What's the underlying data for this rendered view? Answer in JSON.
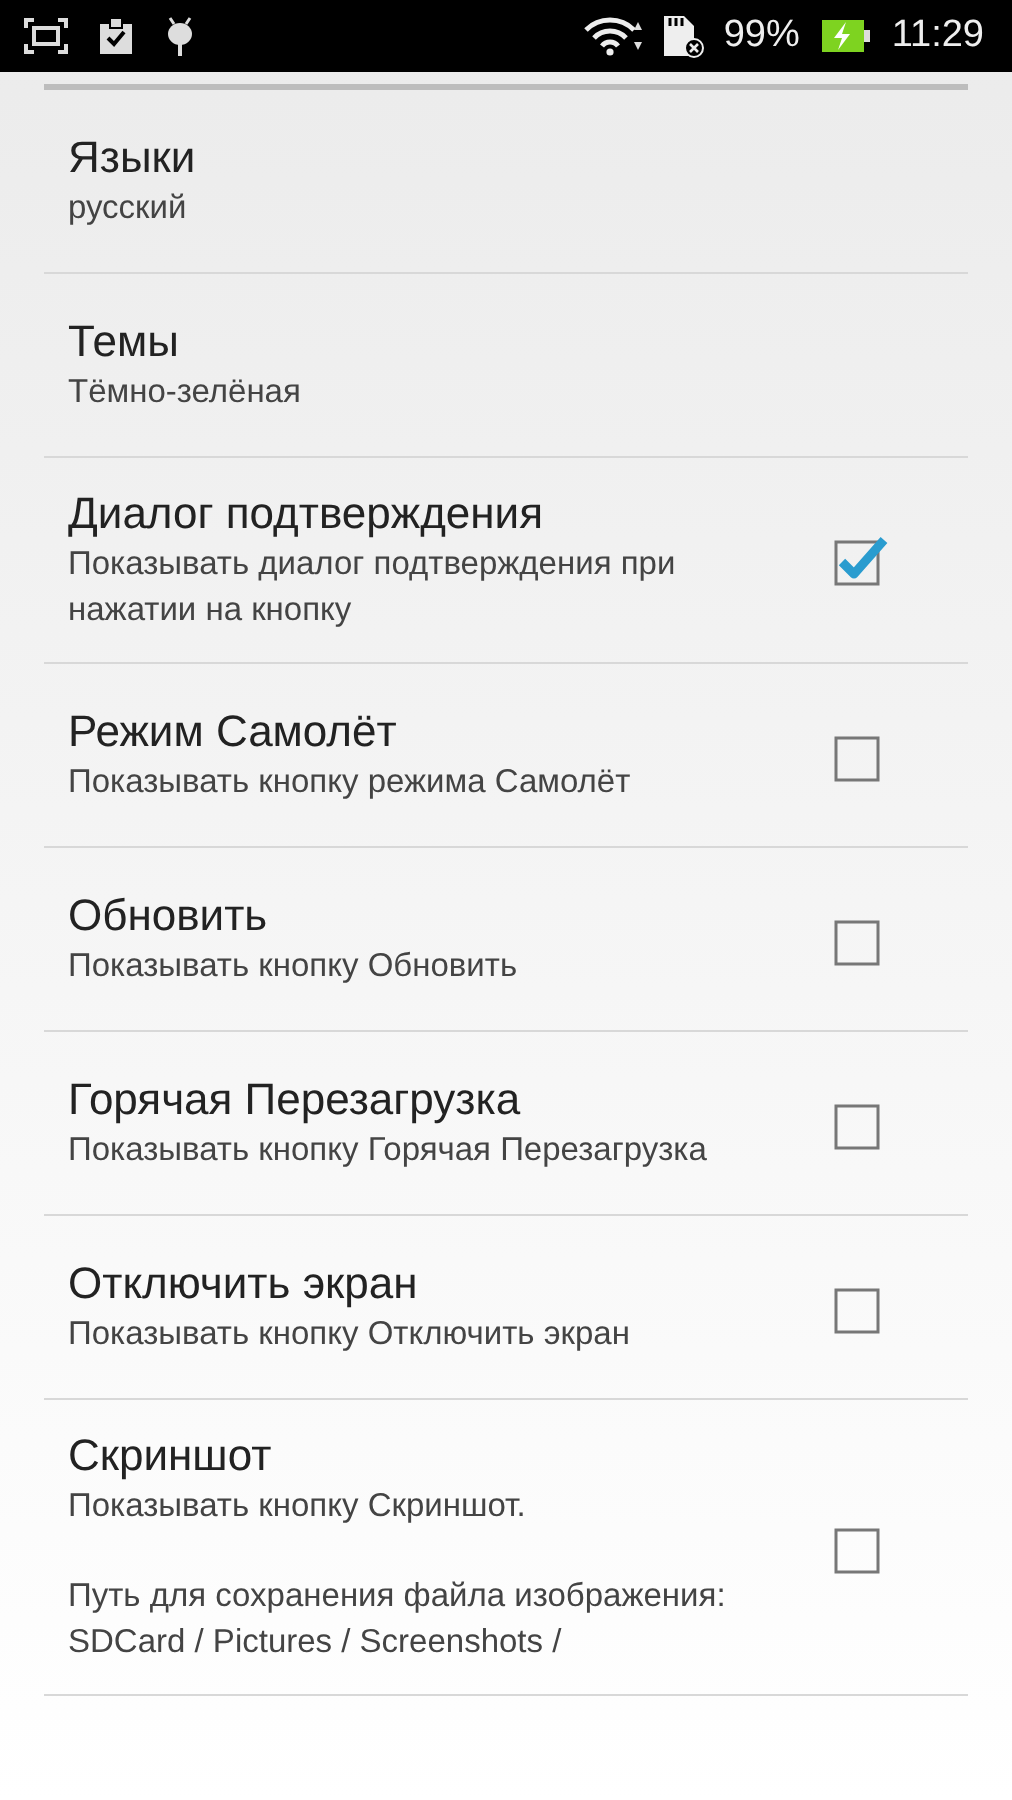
{
  "status_bar": {
    "battery": "99%",
    "time": "11:29"
  },
  "settings": [
    {
      "kind": "value",
      "title": "Языки",
      "summary": [
        "русский"
      ]
    },
    {
      "kind": "value",
      "title": "Темы",
      "summary": [
        "Тёмно-зелёная"
      ]
    },
    {
      "kind": "checkbox",
      "title": "Диалог подтверждения",
      "summary": [
        "Показывать диалог подтверждения при нажатии на кнопку"
      ],
      "checked": true
    },
    {
      "kind": "checkbox",
      "title": "Режим Самолёт",
      "summary": [
        "Показывать кнопку режима Самолёт"
      ],
      "checked": false
    },
    {
      "kind": "checkbox",
      "title": "Обновить",
      "summary": [
        "Показывать кнопку Обновить"
      ],
      "checked": false
    },
    {
      "kind": "checkbox",
      "title": "Горячая Перезагрузка",
      "summary": [
        "Показывать кнопку Горячая Перезагрузка"
      ],
      "checked": false
    },
    {
      "kind": "checkbox",
      "title": "Отключить экран",
      "summary": [
        "Показывать кнопку Отключить экран"
      ],
      "checked": false
    },
    {
      "kind": "checkbox",
      "title": "Скриншот",
      "summary": [
        "Показывать кнопку Скриншот.",
        "Путь для сохранения файла изображения: SDCard / Pictures / Screenshots /"
      ],
      "checked": false
    }
  ]
}
